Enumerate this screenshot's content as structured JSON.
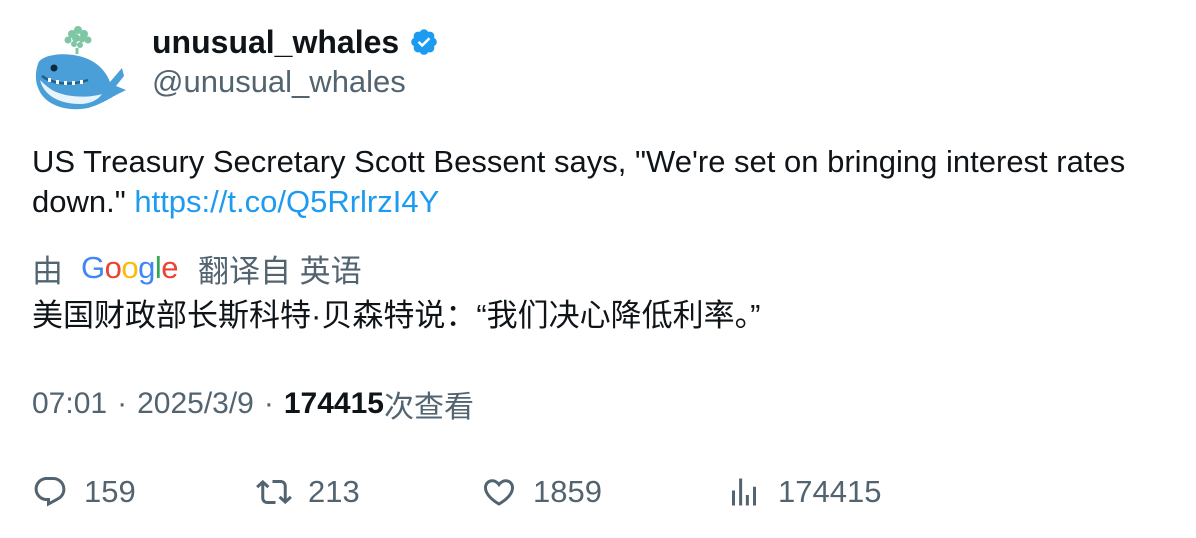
{
  "user": {
    "display_name": "unusual_whales",
    "handle": "@unusual_whales",
    "verified_icon": "verified-badge-icon",
    "avatar_icon": "whale-avatar"
  },
  "tweet": {
    "text": "US Treasury Secretary Scott Bessent says, \"We're set on bringing interest rates down.\" ",
    "link": "https://t.co/Q5RrlrzI4Y"
  },
  "translation": {
    "by_label": "由",
    "provider": "Google",
    "from_label": "翻译自 英语",
    "text": "美国财政部长斯科特·贝森特说：“我们决心降低利率。”"
  },
  "meta": {
    "time": "07:01",
    "separator": "·",
    "date": "2025/3/9",
    "views": "174415",
    "views_suffix": "次查看"
  },
  "actions": {
    "replies": "159",
    "retweets": "213",
    "likes": "1859",
    "views": "174415"
  },
  "colors": {
    "text": "#0f1419",
    "secondary": "#536471",
    "link": "#1d9bf0",
    "verified": "#1d9bf0"
  }
}
